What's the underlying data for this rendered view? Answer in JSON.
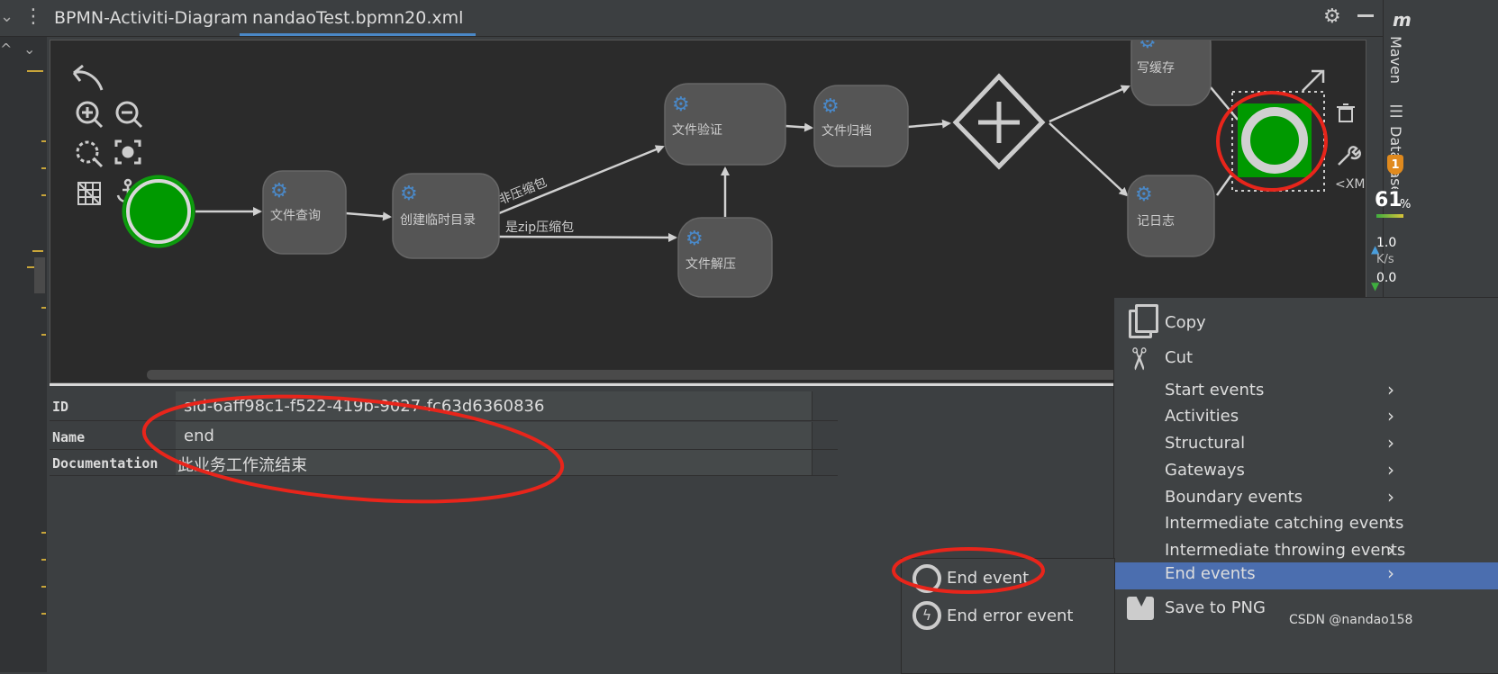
{
  "tabs": {
    "tab1": "BPMN-Activiti-Diagram",
    "tab2": "nandaoTest.bpmn20.xml"
  },
  "right_panel": {
    "maven": "Maven",
    "database": "Database",
    "percent": "61",
    "percent_unit": "%",
    "up_value": "1.0",
    "unit": "K/s",
    "down_value": "0.0",
    "badge": "1",
    "xml_hint": "<XM"
  },
  "diagram": {
    "nodes": {
      "query": "文件查询",
      "tempdir": "创建临时目录",
      "verify": "文件验证",
      "archive": "文件归档",
      "unzip": "文件解压",
      "cache": "写缓存",
      "log": "记日志"
    },
    "edges": {
      "non_zip": "非压缩包",
      "is_zip": "是zip压缩包"
    }
  },
  "properties": {
    "rows": [
      {
        "key": "ID",
        "value": "sid-6aff98c1-f522-419b-9027-fc63d6360836"
      },
      {
        "key": "Name",
        "value": "end"
      },
      {
        "key": "Documentation",
        "value": "此业务工作流结束"
      }
    ]
  },
  "context_menu": {
    "copy": "Copy",
    "cut": "Cut",
    "items": [
      "Start events",
      "Activities",
      "Structural",
      "Gateways",
      "Boundary events",
      "Intermediate catching events",
      "Intermediate throwing events",
      "End events"
    ],
    "save": "Save to PNG"
  },
  "submenu": {
    "end_event": "End event",
    "end_error_event": "End error event"
  },
  "watermark": "CSDN @nandao158",
  "colors": {
    "accent": "#4b6eaf",
    "event_green": "#009900",
    "annotation_red": "#e8251b"
  }
}
